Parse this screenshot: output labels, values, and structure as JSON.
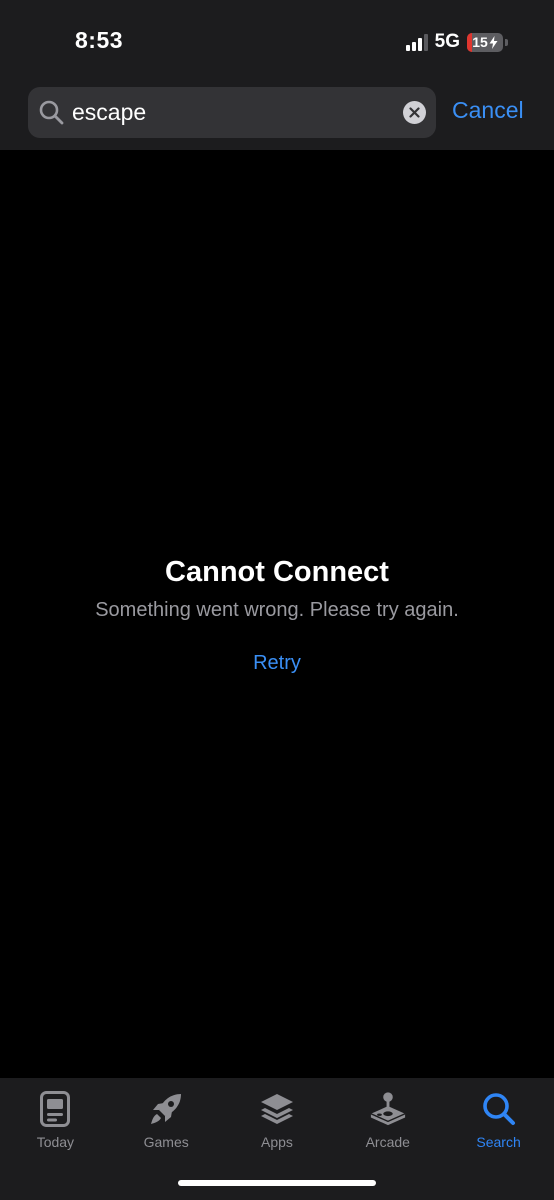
{
  "status_bar": {
    "time": "8:53",
    "network": "5G",
    "battery_level": "15",
    "battery_percent": 15,
    "signal_bars_active": 3,
    "colors": {
      "battery_low": "#e0362f"
    }
  },
  "search": {
    "query": "escape",
    "cancel_label": "Cancel",
    "icons": {
      "search": "magnifier-icon",
      "clear": "clear-x-icon"
    }
  },
  "error": {
    "title": "Cannot Connect",
    "message": "Something went wrong. Please try again.",
    "retry_label": "Retry"
  },
  "tab_bar": {
    "tabs": [
      {
        "label": "Today",
        "icon": "today-icon",
        "active": false
      },
      {
        "label": "Games",
        "icon": "rocket-icon",
        "active": false
      },
      {
        "label": "Apps",
        "icon": "layers-icon",
        "active": false
      },
      {
        "label": "Arcade",
        "icon": "joystick-icon",
        "active": false
      },
      {
        "label": "Search",
        "icon": "search-icon",
        "active": true
      }
    ]
  },
  "colors": {
    "accent": "#3a8ff5",
    "background": "#000000",
    "bar_background": "#1c1c1e"
  }
}
